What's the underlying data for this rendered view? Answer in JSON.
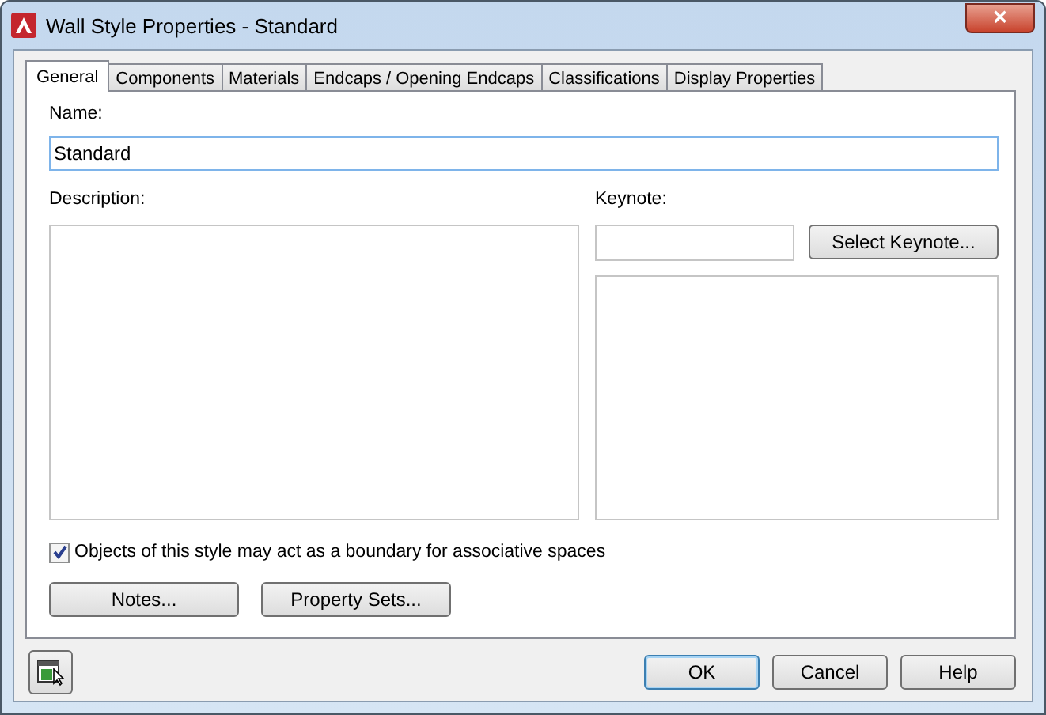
{
  "window": {
    "title": "Wall Style Properties - Standard",
    "close": "✕"
  },
  "tabs": [
    {
      "label": "General",
      "selected": true
    },
    {
      "label": "Components",
      "selected": false
    },
    {
      "label": "Materials",
      "selected": false
    },
    {
      "label": "Endcaps / Opening Endcaps",
      "selected": false
    },
    {
      "label": "Classifications",
      "selected": false
    },
    {
      "label": "Display Properties",
      "selected": false
    }
  ],
  "name": {
    "label": "Name:",
    "value": "Standard"
  },
  "description": {
    "label": "Description:"
  },
  "keynote": {
    "label": "Keynote:",
    "button": "Select Keynote..."
  },
  "boundary_checkbox": {
    "label": "Objects of this style may act as a boundary for associative spaces",
    "checked": true
  },
  "panel_buttons": [
    "Notes...",
    "Property Sets..."
  ],
  "buttons": [
    {
      "label": "OK",
      "default": true
    },
    {
      "label": "Cancel",
      "default": false
    },
    {
      "label": "Help",
      "default": false
    }
  ]
}
